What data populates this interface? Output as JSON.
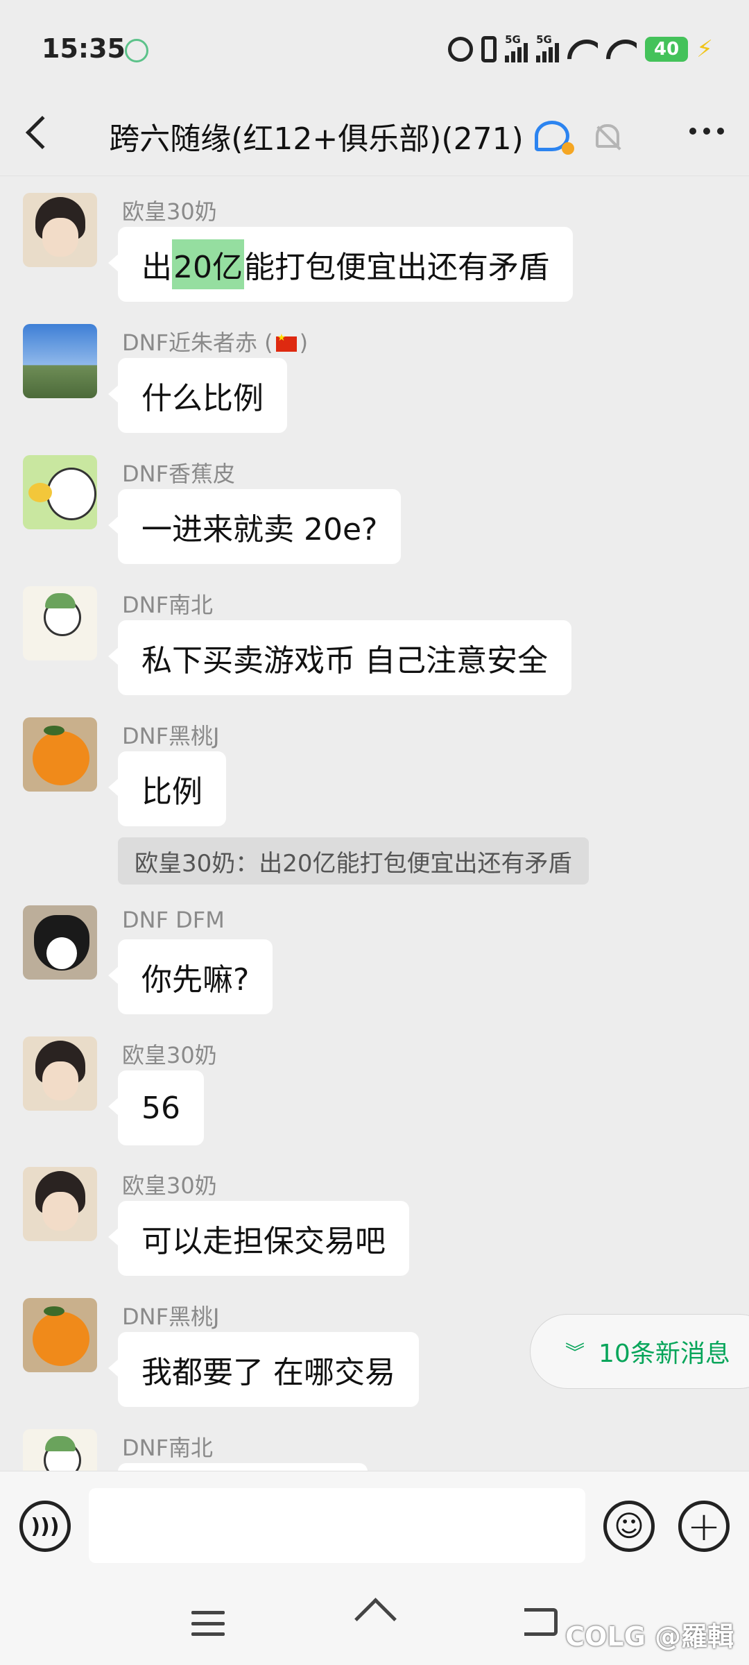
{
  "status_bar": {
    "time": "15:35",
    "signal_1_label": "5G",
    "signal_2_label": "5G",
    "battery": "40",
    "icons": [
      "alarm-icon",
      "vibrate-icon",
      "signal-icon",
      "wifi-icon",
      "battery-icon",
      "charging-icon"
    ]
  },
  "header": {
    "title": "跨六随缘(红12+俱乐部)(271)"
  },
  "messages": [
    {
      "sender": "欧皇30奶",
      "avatar": "girl",
      "pre": "出",
      "highlight": "20亿",
      "post": "能打包便宜出还有矛盾"
    },
    {
      "sender": "DNF近朱者赤",
      "sender_suffix_open": " (",
      "sender_suffix_close": ")",
      "avatar": "sky",
      "text": "什么比例"
    },
    {
      "sender": "DNF香蕉皮",
      "avatar": "cartoon-cat",
      "text": "一进来就卖 20e?"
    },
    {
      "sender": "DNF南北",
      "avatar": "sprout",
      "text": "私下买卖游戏币 自己注意安全"
    },
    {
      "sender": "DNF黑桃J",
      "avatar": "orange",
      "text": "比例",
      "quote": "欧皇30奶：出20亿能打包便宜出还有矛盾"
    },
    {
      "sender": "DNF DFM",
      "avatar": "cat",
      "text": "你先嘛?"
    },
    {
      "sender": "欧皇30奶",
      "avatar": "girl",
      "text": "56"
    },
    {
      "sender": "欧皇30奶",
      "avatar": "girl",
      "text": "可以走担保交易吧"
    },
    {
      "sender": "DNF黑桃J",
      "avatar": "orange",
      "text": "我都要了 在哪交易"
    },
    {
      "sender": "DNF南北",
      "avatar": "sprout",
      "text": ""
    }
  ],
  "new_messages_pill": "10条新消息",
  "input": {
    "value": "",
    "placeholder": ""
  },
  "watermark": "COLG @羅輯"
}
